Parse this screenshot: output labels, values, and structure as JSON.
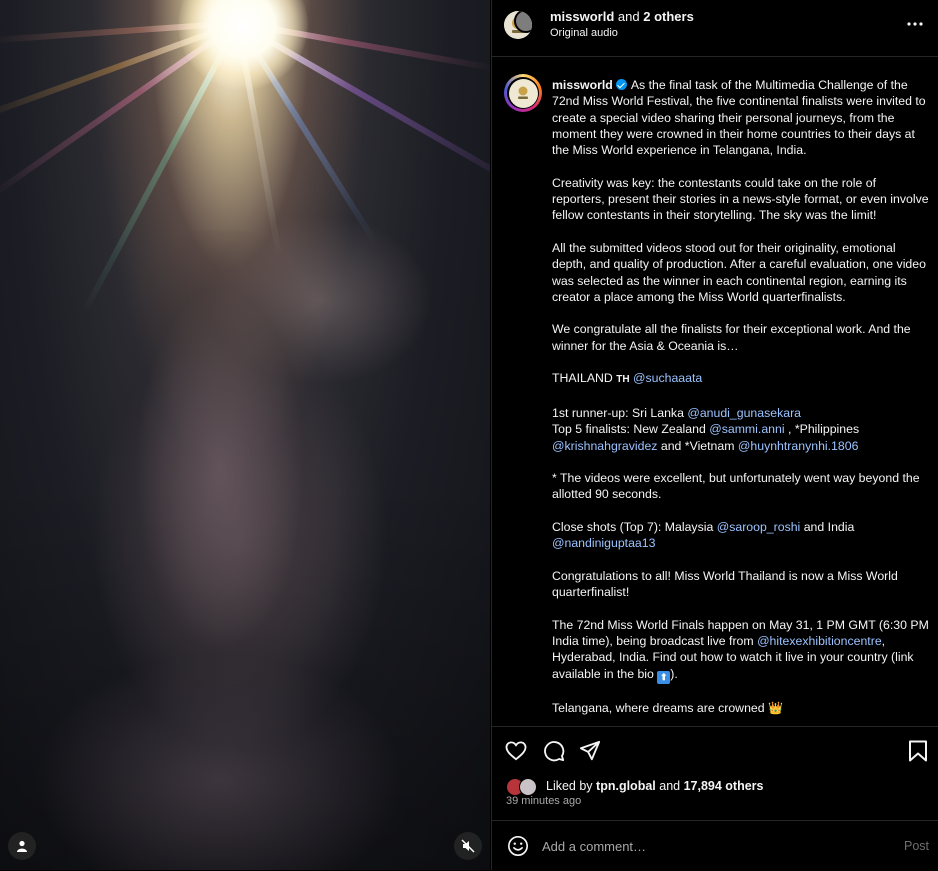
{
  "media": {
    "user_tag_icon": "person-icon",
    "mute_icon": "speaker-muted-icon"
  },
  "header": {
    "username": "missworld",
    "and_text": "and",
    "others": "2 others",
    "audio": "Original audio",
    "more_icon": "more-horizontal-icon"
  },
  "caption": {
    "username": "missworld",
    "p1": "As the final task of the Multimedia Challenge of the 72nd Miss World Festival, the five continental finalists were invited to create a special video sharing their personal journeys, from the moment they were crowned in their home countries to their days at the Miss World experience in Telangana, India.",
    "p2": "Creativity was key: the contestants could take on the role of reporters, present their stories in a news-style format, or even involve fellow contestants in their storytelling. The sky was the limit!",
    "p3": "All the submitted videos stood out for their originality, emotional depth, and quality of production. After a careful evaluation, one video was selected as the winner in each continental region, earning its creator a place among the Miss World quarterfinalists.",
    "p4": "We congratulate all the finalists for their exceptional work. And the winner for the Asia & Oceania is…",
    "winner_country": "THAILAND",
    "winner_flag": "TH",
    "winner_mention": "@suchaaata",
    "runnerup_label": "1st runner-up: Sri Lanka",
    "runnerup_mention": "@anudi_gunasekara",
    "top5_label": "Top 5 finalists: New Zealand",
    "top5_mention1": "@sammi.anni",
    "top5_mid": ", *Philippines",
    "top5_mention2": "@krishnahgravidez",
    "top5_and": "and *Vietnam",
    "top5_mention3": "@huynhtranynhi.1806",
    "note": "* The videos were excellent, but unfortunately went way beyond the allotted 90 seconds.",
    "close_label": "Close shots (Top 7): Malaysia",
    "close_mention1": "@saroop_roshi",
    "close_and": "and India",
    "close_mention2": "@nandiniguptaa13",
    "congrats": "Congratulations to all! Miss World Thailand is now a Miss World quarterfinalist!",
    "finals_pre": "The 72nd Miss World Finals happen on May 31, 1 PM GMT (6:30 PM India time), being broadcast live from",
    "finals_mention": "@hitexexhibitioncentre",
    "finals_post": ", Hyderabad, India. Find out how to watch it live in your country (link available in the bio",
    "finals_emoji": "⬆",
    "finals_end": ").",
    "closing": "Telangana, where dreams are crowned",
    "closing_emoji": "👑"
  },
  "actions": {
    "like_icon": "heart-icon",
    "comment_icon": "comment-icon",
    "share_icon": "share-icon",
    "save_icon": "bookmark-icon"
  },
  "likes": {
    "prefix": "Liked by",
    "user": "tpn.global",
    "and": "and",
    "count": "17,894 others"
  },
  "time_ago": "39 minutes ago",
  "comment": {
    "emoji_icon": "smiley-icon",
    "placeholder": "Add a comment…",
    "post_label": "Post"
  }
}
